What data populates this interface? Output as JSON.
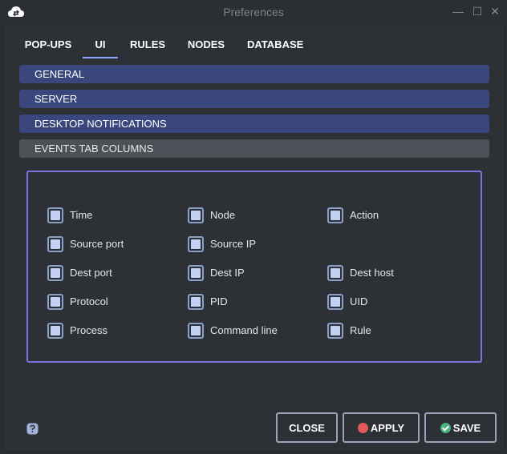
{
  "window": {
    "title": "Preferences",
    "minimize_glyph": "—",
    "maximize_glyph": "☐",
    "close_glyph": "✕"
  },
  "tabs": [
    {
      "label": "POP-UPS",
      "active": false
    },
    {
      "label": "UI",
      "active": true
    },
    {
      "label": "RULES",
      "active": false
    },
    {
      "label": "NODES",
      "active": false
    },
    {
      "label": "DATABASE",
      "active": false
    }
  ],
  "sections": [
    {
      "label": "GENERAL",
      "style": "blue"
    },
    {
      "label": "SERVER",
      "style": "blue"
    },
    {
      "label": "DESKTOP NOTIFICATIONS",
      "style": "blue"
    },
    {
      "label": "EVENTS TAB COLUMNS",
      "style": "grey"
    }
  ],
  "columns": {
    "time": {
      "label": "Time",
      "checked": true
    },
    "node": {
      "label": "Node",
      "checked": true
    },
    "action": {
      "label": "Action",
      "checked": true
    },
    "source_port": {
      "label": "Source port",
      "checked": true
    },
    "source_ip": {
      "label": "Source IP",
      "checked": true
    },
    "dest_port": {
      "label": "Dest port",
      "checked": true
    },
    "dest_ip": {
      "label": "Dest IP",
      "checked": true
    },
    "dest_host": {
      "label": "Dest host",
      "checked": true
    },
    "protocol": {
      "label": "Protocol",
      "checked": true
    },
    "pid": {
      "label": "PID",
      "checked": true
    },
    "uid": {
      "label": "UID",
      "checked": true
    },
    "process": {
      "label": "Process",
      "checked": true
    },
    "command_line": {
      "label": "Command line",
      "checked": true
    },
    "rule": {
      "label": "Rule",
      "checked": true
    }
  },
  "buttons": {
    "close": "CLOSE",
    "apply": "APPLY",
    "save": "SAVE"
  },
  "colors": {
    "accent": "#7a74e0",
    "section_blue": "#39477c",
    "section_grey": "#4b5157",
    "apply_icon": "#e05a5a",
    "save_icon": "#45b37a"
  },
  "icons": {
    "app": "cloud-icon",
    "help": "help-icon",
    "apply": "apply-icon",
    "save": "check-icon"
  }
}
